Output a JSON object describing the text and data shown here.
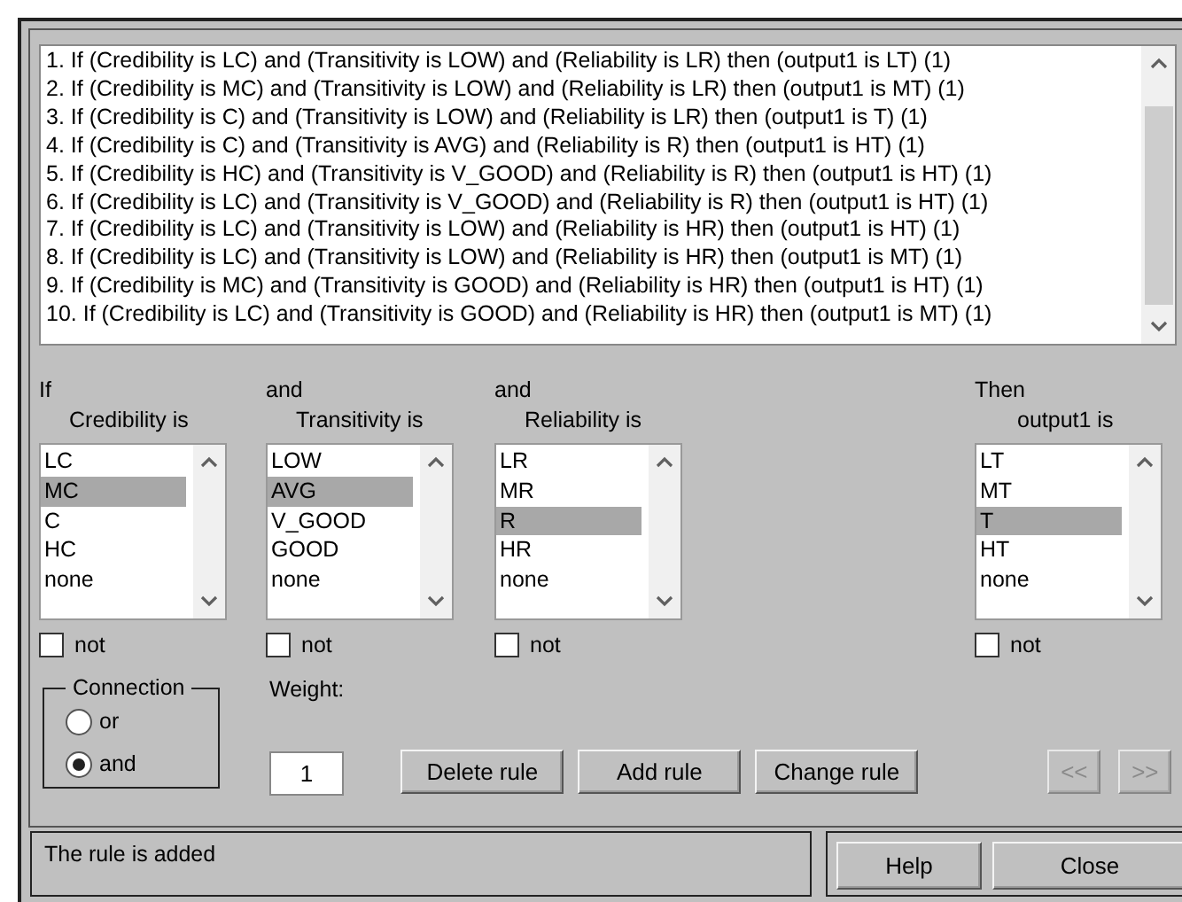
{
  "rules": [
    "1. If (Credibility is LC) and (Transitivity is LOW) and (Reliability is LR) then (output1 is LT) (1)",
    "2. If (Credibility is MC) and (Transitivity is LOW) and (Reliability is LR) then (output1 is MT) (1)",
    "3. If (Credibility is C) and (Transitivity is LOW) and (Reliability is LR) then (output1 is T) (1)",
    "4. If (Credibility is C) and (Transitivity is AVG) and (Reliability is R) then (output1 is HT) (1)",
    "5. If (Credibility is HC) and (Transitivity is V_GOOD) and (Reliability is R) then (output1 is HT) (1)",
    "6. If (Credibility is LC) and (Transitivity is V_GOOD) and (Reliability is R) then (output1 is HT) (1)",
    "7. If (Credibility is LC) and (Transitivity is LOW) and (Reliability is HR) then (output1 is HT) (1)",
    "8. If (Credibility is LC) and (Transitivity is LOW) and (Reliability is HR) then (output1 is MT) (1)",
    "9. If (Credibility is MC) and (Transitivity is GOOD) and (Reliability is HR) then (output1 is HT) (1)",
    "10. If (Credibility is LC) and (Transitivity is GOOD) and (Reliability is HR) then (output1 is MT) (1)"
  ],
  "columns": [
    {
      "kind": "input",
      "connective": "If",
      "label": "Credibility is",
      "not_label": "not",
      "not": false,
      "items": [
        {
          "label": "LC",
          "selected": false
        },
        {
          "label": "MC",
          "selected": true
        },
        {
          "label": "C",
          "selected": false
        },
        {
          "label": "HC",
          "selected": false
        },
        {
          "label": "none",
          "selected": false
        }
      ]
    },
    {
      "kind": "input",
      "connective": "and",
      "label": "Transitivity is",
      "not_label": "not",
      "not": false,
      "items": [
        {
          "label": "LOW",
          "selected": false
        },
        {
          "label": "AVG",
          "selected": true
        },
        {
          "label": "V_GOOD",
          "selected": false
        },
        {
          "label": "GOOD",
          "selected": false
        },
        {
          "label": "none",
          "selected": false
        }
      ]
    },
    {
      "kind": "input",
      "connective": "and",
      "label": "Reliability is",
      "not_label": "not",
      "not": false,
      "items": [
        {
          "label": "LR",
          "selected": false
        },
        {
          "label": "MR",
          "selected": false
        },
        {
          "label": "R",
          "selected": true
        },
        {
          "label": "HR",
          "selected": false
        },
        {
          "label": "none",
          "selected": false
        }
      ]
    },
    {
      "kind": "output",
      "connective": "Then",
      "label": "output1 is",
      "not_label": "not",
      "not": false,
      "items": [
        {
          "label": "LT",
          "selected": false
        },
        {
          "label": "MT",
          "selected": false
        },
        {
          "label": "T",
          "selected": true
        },
        {
          "label": "HT",
          "selected": false
        },
        {
          "label": "none",
          "selected": false
        }
      ]
    }
  ],
  "connection": {
    "title": "Connection",
    "options": [
      {
        "label": "or",
        "selected": false
      },
      {
        "label": "and",
        "selected": true
      }
    ]
  },
  "weight": {
    "label": "Weight:",
    "value": "1"
  },
  "buttons": [
    {
      "label": "Delete rule",
      "disabled": false
    },
    {
      "label": "Add rule",
      "disabled": false
    },
    {
      "label": "Change rule",
      "disabled": false
    }
  ],
  "nav_buttons": [
    {
      "label": "<<",
      "disabled": true
    },
    {
      "label": ">>",
      "disabled": true
    }
  ],
  "status": "The rule is added",
  "footer_buttons": [
    {
      "label": "Help",
      "disabled": false
    },
    {
      "label": "Close",
      "disabled": false
    }
  ]
}
